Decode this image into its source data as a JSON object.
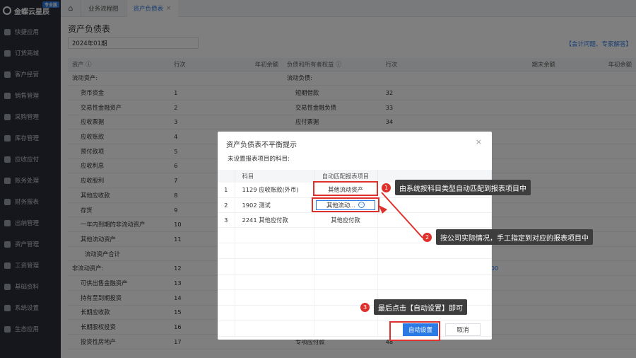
{
  "app": {
    "brand_name": "金蝶云星辰",
    "brand_badge": "专业版"
  },
  "sidebar": {
    "items": [
      {
        "label": "快捷应用",
        "icon": "grid-icon"
      },
      {
        "label": "订货商城",
        "icon": "store-icon"
      },
      {
        "label": "客户经营",
        "icon": "customer-icon"
      },
      {
        "label": "销售管理",
        "icon": "sales-icon"
      },
      {
        "label": "采购管理",
        "icon": "cart-icon"
      },
      {
        "label": "库存管理",
        "icon": "box-icon"
      },
      {
        "label": "应收应付",
        "icon": "money-icon"
      },
      {
        "label": "账务处理",
        "icon": "ledger-icon"
      },
      {
        "label": "财务报表",
        "icon": "report-icon"
      },
      {
        "label": "出纳管理",
        "icon": "cashier-icon"
      },
      {
        "label": "资产管理",
        "icon": "asset-icon"
      },
      {
        "label": "工资管理",
        "icon": "salary-icon"
      },
      {
        "label": "基础资料",
        "icon": "data-icon"
      },
      {
        "label": "系统设置",
        "icon": "settings-icon"
      },
      {
        "label": "生态应用",
        "icon": "apps-icon"
      }
    ]
  },
  "tabs": [
    {
      "label": "业务流程图"
    },
    {
      "label": "资产负债表",
      "close": "×"
    }
  ],
  "page": {
    "title": "资产负债表",
    "period": "2024年01期",
    "help_links": "【会计问题、专家解答】"
  },
  "table": {
    "headers": [
      "资产 ⓘ",
      "行次",
      "年初余额",
      "负债和所有者权益 ⓘ",
      "行次",
      "期末余额",
      "年初余额"
    ],
    "rows": [
      {
        "a": "流动资产:",
        "an": "",
        "l": "流动负债:",
        "ln": ""
      },
      {
        "a": "货币资金",
        "an": "1",
        "l": "短期借款",
        "ln": "32"
      },
      {
        "a": "交易性金融资产",
        "an": "2",
        "l": "交易性金融负债",
        "ln": "33"
      },
      {
        "a": "应收票据",
        "an": "3",
        "l": "应付票据",
        "ln": "34"
      },
      {
        "a": "应收账款",
        "an": "4",
        "l": "",
        "ln": ""
      },
      {
        "a": "预付款项",
        "an": "5",
        "l": "",
        "ln": ""
      },
      {
        "a": "应收利息",
        "an": "6",
        "l": "",
        "ln": ""
      },
      {
        "a": "应收股利",
        "an": "7",
        "l": "",
        "ln": ""
      },
      {
        "a": "其他应收款",
        "an": "8",
        "l": "",
        "ln": ""
      },
      {
        "a": "存货",
        "an": "9",
        "l": "",
        "ln": ""
      },
      {
        "a": "一年内到期的非流动资产",
        "an": "10",
        "l": "",
        "ln": ""
      },
      {
        "a": "其他流动资产",
        "an": "11",
        "l": "",
        "ln": ""
      },
      {
        "a": "流动资产合计",
        "an": "",
        "l": "",
        "ln": ""
      },
      {
        "a": "非流动资产:",
        "an": "12",
        "l": "",
        "ln": ""
      },
      {
        "a": "可供出售金融资产",
        "an": "13",
        "l": "",
        "ln": ""
      },
      {
        "a": "持有至到期投资",
        "an": "14",
        "l": "",
        "ln": ""
      },
      {
        "a": "长期应收款",
        "an": "15",
        "l": "",
        "ln": ""
      },
      {
        "a": "长期股权投资",
        "an": "16",
        "l": "",
        "ln": ""
      },
      {
        "a": "投资性房地产",
        "an": "17",
        "l": "专项应付款",
        "ln": "48"
      }
    ],
    "partial_value": ".00"
  },
  "dialog": {
    "title": "资产负债表不平衡提示",
    "close": "×",
    "subtitle": "未设置报表项目的科目:",
    "col_subject": "科目",
    "col_match": "自动匹配报表项目",
    "rows": [
      {
        "no": "1",
        "subject": "1129 应收账款(外币)",
        "match": "其他流动资产"
      },
      {
        "no": "2",
        "subject": "1902 测试",
        "match": "其他流动..."
      },
      {
        "no": "3",
        "subject": "2241 其他应付款",
        "match": "其他应付款"
      }
    ],
    "more_icon": "⋯",
    "btn_auto": "自动设置",
    "btn_cancel": "取消"
  },
  "annotations": [
    {
      "num": "1",
      "text": "由系统按科目类型自动匹配到报表项目中"
    },
    {
      "num": "2",
      "text": "按公司实际情况，手工指定到对应的报表项目中"
    },
    {
      "num": "3",
      "text": "最后点击【自动设置】即可"
    }
  ],
  "colors": {
    "sidebar_bg": "#2b2f3a",
    "accent": "#2c7be5",
    "annotation_red": "#e0302b",
    "callout_bg": "#3d3d3d"
  }
}
